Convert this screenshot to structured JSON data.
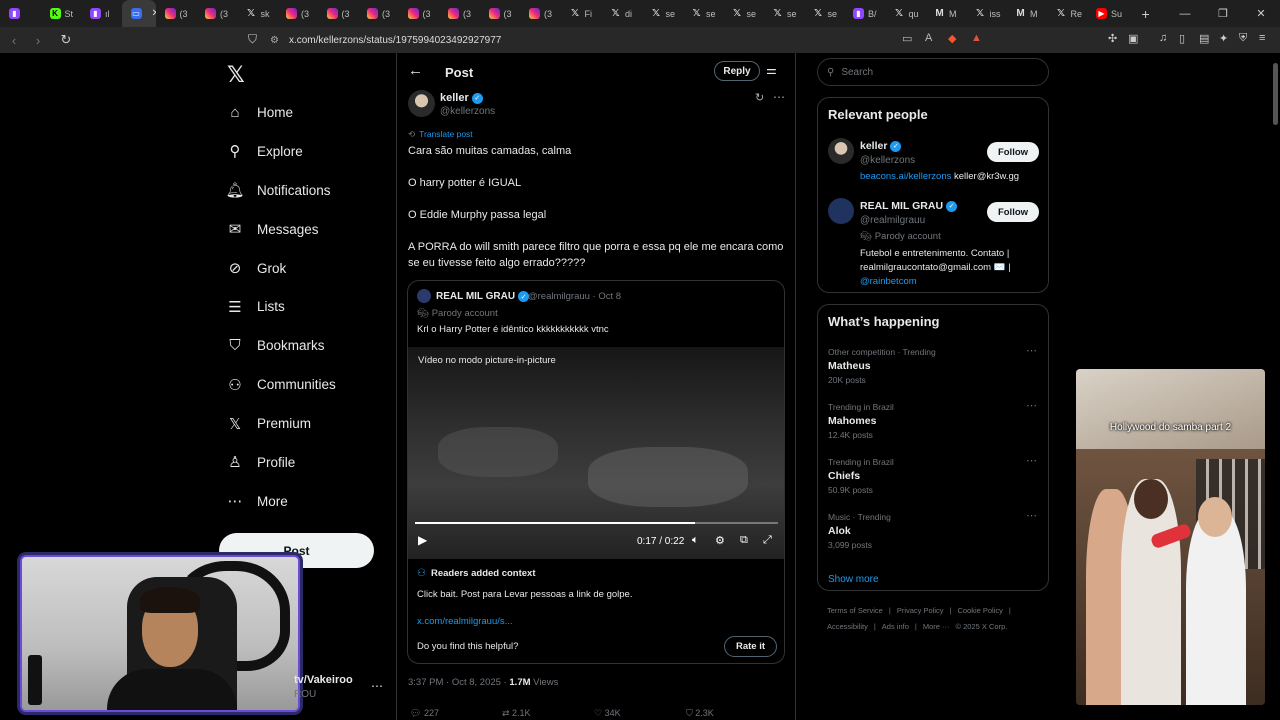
{
  "browser": {
    "tabs": [
      {
        "label": "",
        "icon": "twitch-icon",
        "active": false
      },
      {
        "label": "St",
        "icon": "kick-icon",
        "active": false
      },
      {
        "label": "ıl",
        "icon": "twitch-icon",
        "active": false
      },
      {
        "label": "",
        "icon": "window-icon",
        "active": true
      },
      {
        "label": "(3",
        "icon": "instagram-icon",
        "active": false
      },
      {
        "label": "(3",
        "icon": "instagram-icon",
        "active": false
      },
      {
        "label": "sk",
        "icon": "x-icon",
        "active": false
      },
      {
        "label": "(3",
        "icon": "instagram-icon",
        "active": false
      },
      {
        "label": "(3",
        "icon": "instagram-icon",
        "active": false
      },
      {
        "label": "(3",
        "icon": "instagram-icon",
        "active": false
      },
      {
        "label": "(3",
        "icon": "instagram-icon",
        "active": false
      },
      {
        "label": "(3",
        "icon": "instagram-icon",
        "active": false
      },
      {
        "label": "(3",
        "icon": "instagram-icon",
        "active": false
      },
      {
        "label": "(3",
        "icon": "instagram-icon",
        "active": false
      },
      {
        "label": "Fi",
        "icon": "x-icon",
        "active": false
      },
      {
        "label": "di",
        "icon": "x-icon",
        "active": false
      },
      {
        "label": "se",
        "icon": "x-icon",
        "active": false
      },
      {
        "label": "se",
        "icon": "x-icon",
        "active": false
      },
      {
        "label": "se",
        "icon": "x-icon",
        "active": false
      },
      {
        "label": "se",
        "icon": "x-icon",
        "active": false
      },
      {
        "label": "se",
        "icon": "x-icon",
        "active": false
      },
      {
        "label": "B/",
        "icon": "twitch-icon",
        "active": false
      },
      {
        "label": "qu",
        "icon": "x-icon",
        "active": false
      },
      {
        "label": "M",
        "icon": "gmail-icon",
        "active": false
      },
      {
        "label": "iss",
        "icon": "x-icon",
        "active": false
      },
      {
        "label": "M",
        "icon": "gmail-icon",
        "active": false
      },
      {
        "label": "Re",
        "icon": "x-icon",
        "active": false
      },
      {
        "label": "Su",
        "icon": "youtube-icon",
        "active": false
      }
    ],
    "url": "x.com/kellerzons/status/1975994023492927977"
  },
  "nav": {
    "items": [
      {
        "label": "Home",
        "icon": "home-icon",
        "glyph": "⌂"
      },
      {
        "label": "Explore",
        "icon": "search-icon",
        "glyph": "⚲"
      },
      {
        "label": "Notifications",
        "icon": "bell-icon",
        "glyph": "🔔︎"
      },
      {
        "label": "Messages",
        "icon": "mail-icon",
        "glyph": "✉"
      },
      {
        "label": "Grok",
        "icon": "grok-icon",
        "glyph": "⊘"
      },
      {
        "label": "Lists",
        "icon": "list-icon",
        "glyph": "☰"
      },
      {
        "label": "Bookmarks",
        "icon": "bookmark-icon",
        "glyph": "⛉"
      },
      {
        "label": "Communities",
        "icon": "people-icon",
        "glyph": "⚇"
      },
      {
        "label": "Premium",
        "icon": "x-logo-icon",
        "glyph": "𝕏"
      },
      {
        "label": "Profile",
        "icon": "person-icon",
        "glyph": "♙"
      },
      {
        "label": "More",
        "icon": "more-circle-icon",
        "glyph": "⋯"
      }
    ],
    "post_button": "Post"
  },
  "account": {
    "handle": "tv/Vakeiroo",
    "sub": "ROU"
  },
  "main": {
    "header_title": "Post",
    "reply_label": "Reply",
    "author": {
      "name": "keller",
      "handle": "@kellerzons"
    },
    "translate": "Translate post",
    "text_lines": [
      "Cara são muitas camadas, calma",
      "O harry potter é IGUAL",
      "O Eddie Murphy passa legal",
      "A PORRA do will smith parece filtro que porra e essa pq ele me encara como se eu tivesse feito algo errado?????"
    ],
    "quote": {
      "name": "REAL MIL GRAU",
      "meta": "@realmilgrauu · Oct 8",
      "parody": "Parody account",
      "text": "Krl o Harry Potter é idêntico kkkkkkkkkkk vtnc",
      "video_notice": "Vídeo no modo picture-in-picture",
      "time": "0:17 / 0:22",
      "progress": 0.77,
      "context_title": "Readers added context",
      "context_text": "Click bait. Post para Levar pessoas a link de golpe.",
      "context_link": "x.com/realmilgrauu/s...",
      "helpful_q": "Do you find this helpful?",
      "rate_label": "Rate it"
    },
    "timestamp": "3:37 PM · Oct 8, 2025 · ",
    "views_count": "1.7M",
    "views_label": " Views",
    "engagement": {
      "replies": "227",
      "reposts": "2.1K",
      "likes": "34K",
      "bookmarks": "2.3K"
    }
  },
  "sidebar": {
    "search_placeholder": "Search",
    "relevant_title": "Relevant people",
    "people": [
      {
        "name": "keller",
        "handle": "@kellerzons",
        "follow": "Follow",
        "bio_link": "beacons.ai/kellerzons",
        "bio_rest": " keller@kr3w.gg"
      },
      {
        "name": "REAL MIL GRAU",
        "handle": "@realmilgrauu",
        "follow": "Follow",
        "parody": "Parody account",
        "bio1": "Futebol e entretenimento. Contato |",
        "bio2": "realmilgraucontato@gmail.com ✉️ |",
        "bio3": "@rainbetcom"
      }
    ],
    "happening_title": "What’s happening",
    "trends": [
      {
        "meta": "Other competition · Trending",
        "name": "Matheus",
        "count": "20K posts"
      },
      {
        "meta": "Trending in Brazil",
        "name": "Mahomes",
        "count": "12.4K posts"
      },
      {
        "meta": "Trending in Brazil",
        "name": "Chiefs",
        "count": "50.9K posts"
      },
      {
        "meta": "Music · Trending",
        "name": "Alok",
        "count": "3,099 posts"
      }
    ],
    "show_more": "Show more",
    "footer1": [
      "Terms of Service",
      "|",
      "Privacy Policy",
      "|",
      "Cookie Policy",
      "|"
    ],
    "footer2": [
      "Accessibility",
      "|",
      "Ads info",
      "|",
      "More ···",
      "© 2025 X Corp."
    ]
  },
  "pip": {
    "caption": "Hollywood do samba part 2"
  }
}
